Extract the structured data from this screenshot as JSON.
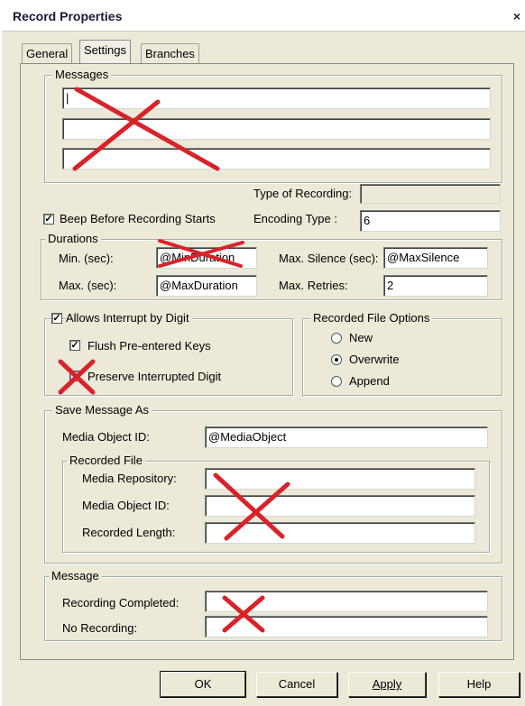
{
  "window": {
    "title": "Record Properties",
    "close_label": "×"
  },
  "tabs": [
    {
      "label": "General",
      "active": false
    },
    {
      "label": "Settings",
      "active": true
    },
    {
      "label": "Branches",
      "active": false
    }
  ],
  "messages": {
    "legend": "Messages",
    "lines": [
      "|",
      "",
      ""
    ]
  },
  "type_of_recording": {
    "label": "Type of Recording:",
    "value": ""
  },
  "encoding_type": {
    "label": "Encoding Type :",
    "value": "6"
  },
  "beep": {
    "label": "Beep Before Recording Starts",
    "checked": true,
    "check_glyph": "✓"
  },
  "durations": {
    "legend": "Durations",
    "min_label": "Min. (sec):",
    "min_value": "@MinDuration",
    "max_label": "Max. (sec):",
    "max_value": "@MaxDuration",
    "max_silence_label": "Max. Silence (sec):",
    "max_silence_value": "@MaxSilence",
    "max_retries_label": "Max. Retries:",
    "max_retries_value": "2"
  },
  "interrupt": {
    "legend": "Allows Interrupt by Digit",
    "checked": true,
    "flush_label": "Flush Pre-entered Keys",
    "flush_checked": true,
    "preserve_label": "Preserve Interrupted Digit",
    "preserve_checked": false
  },
  "file_options": {
    "legend": "Recorded File Options",
    "options": [
      "New",
      "Overwrite",
      "Append"
    ],
    "selected": "Overwrite"
  },
  "save_as": {
    "legend": "Save Message As",
    "media_object_label": "Media Object ID:",
    "media_object_value": "@MediaObject",
    "recorded_file": {
      "legend": "Recorded File",
      "repository_label": "Media Repository:",
      "repository_value": "",
      "object_id_label": "Media Object ID:",
      "object_id_value": "",
      "length_label": "Recorded Length:",
      "length_value": ""
    }
  },
  "message": {
    "legend": "Message",
    "completed_label": "Recording Completed:",
    "completed_value": "",
    "no_recording_label": "No Recording:",
    "no_recording_value": ""
  },
  "buttons": {
    "ok": "OK",
    "cancel": "Cancel",
    "apply": "Apply",
    "help": "Help"
  },
  "annotation_color": "#d8232a"
}
